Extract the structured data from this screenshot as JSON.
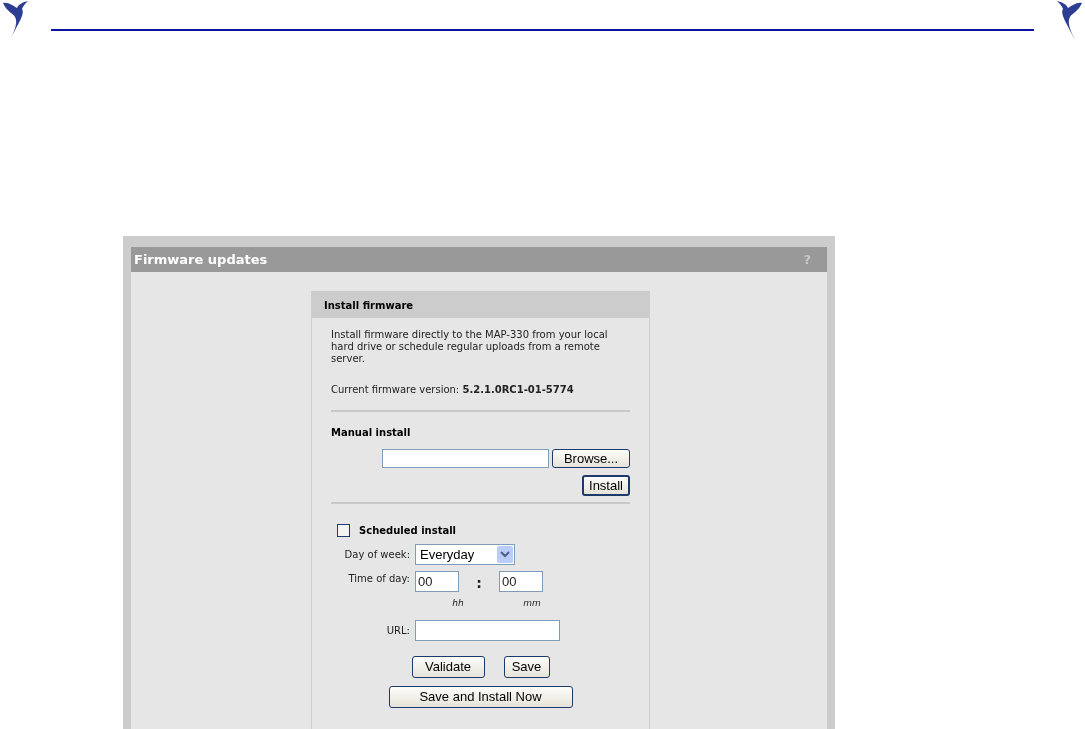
{
  "panel": {
    "title": "Firmware updates",
    "help": "?"
  },
  "card": {
    "title": "Install firmware",
    "intro": "Install firmware directly to the MAP-330 from your local hard drive or schedule regular uploads from a remote server.",
    "version": "Current firmware version: **5.2.1.0RC1-01-5774**",
    "manual": {
      "heading": "Manual install",
      "browse": "Browse...",
      "install": "Install"
    },
    "scheduled": {
      "label": "Scheduled install",
      "checked": false,
      "day_label": "Day of week:",
      "day_value": "Everyday",
      "time_label": "Time of day:",
      "hh_value": "00",
      "separator": ":",
      "mm_value": "00",
      "hh_hint": "hh",
      "mm_hint": "mm",
      "url_label": "URL:"
    },
    "buttons": [
      "Validate",
      "Save",
      "Save and Install Now"
    ]
  }
}
